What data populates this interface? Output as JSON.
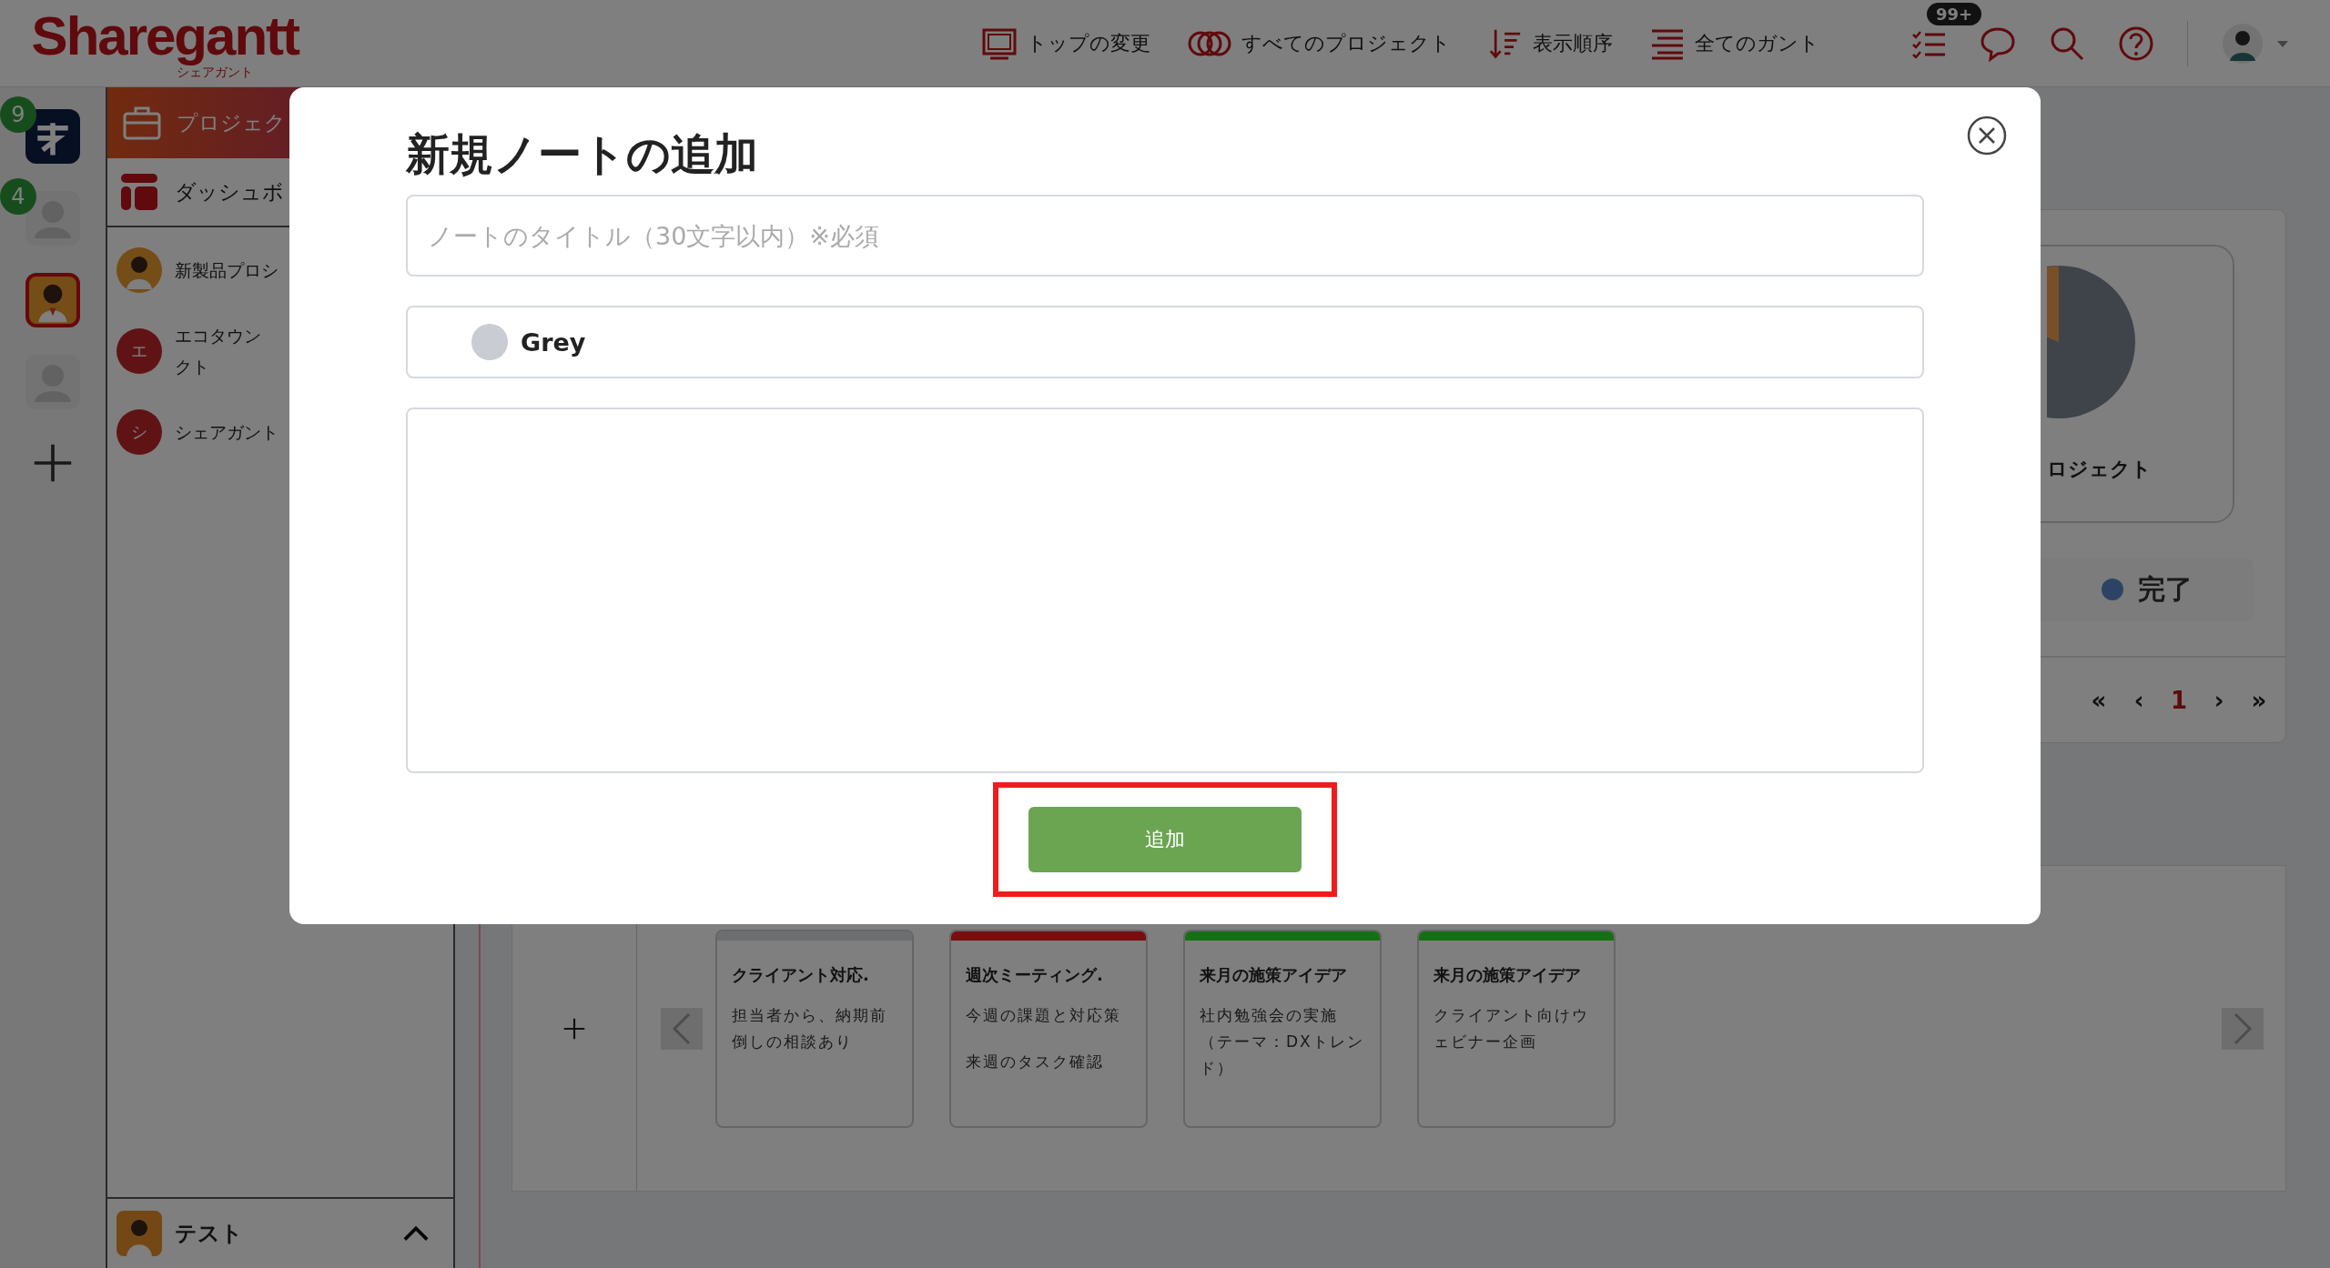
{
  "header": {
    "logo": "Sharegantt",
    "logo_sub": "シェアガント",
    "nav": [
      {
        "kind": "monitor",
        "label": "トップの変更"
      },
      {
        "kind": "rings",
        "label": "すべてのプロジェクト"
      },
      {
        "kind": "sort",
        "label": "表示順序"
      },
      {
        "kind": "lines",
        "label": "全てのガント"
      }
    ],
    "task_badge": "99+"
  },
  "rail": [
    {
      "kind": "app",
      "badge": "9",
      "selected": false
    },
    {
      "kind": "person",
      "badge": "4",
      "selected": false
    },
    {
      "kind": "character",
      "selected": true
    },
    {
      "kind": "person",
      "selected": false
    },
    {
      "kind": "add",
      "selected": false
    }
  ],
  "sidebar": {
    "title": "プロジェク",
    "dashboard": "ダッシュボ",
    "projects": [
      {
        "kind": "character",
        "lines": [
          "新製品プロシ"
        ]
      },
      {
        "kind": "initial",
        "initial": "エ",
        "lines": [
          "エコタウン",
          "クト"
        ]
      },
      {
        "kind": "initial",
        "initial": "シ",
        "lines": [
          "シェアガント"
        ]
      }
    ],
    "footer": {
      "label": "テスト",
      "expanded": true
    }
  },
  "summary": {
    "chart_label": "ロジェクト",
    "legend": [
      {
        "label": "完了",
        "color": "#2b4466"
      }
    ],
    "pagination": [
      {
        "label": "«",
        "selected": false
      },
      {
        "label": "‹",
        "selected": false
      },
      {
        "label": "1",
        "selected": true
      },
      {
        "label": "›",
        "selected": false
      },
      {
        "label": "»",
        "selected": false
      }
    ]
  },
  "notes": [
    {
      "title": "クライアント対応.",
      "paragraphs": [
        "担当者から、納期前倒しの相談あり"
      ],
      "color": "#6d6e70"
    },
    {
      "title": "週次ミーティング.",
      "paragraphs": [
        "今週の課題と対応策",
        "来週のタスク確認"
      ],
      "color": "#7a0d10"
    },
    {
      "title": "来月の施策アイデア",
      "paragraphs": [
        "社内勉強会の実施（テーマ：DXトレンド）"
      ],
      "color": "#157015"
    },
    {
      "title": "来月の施策アイデア",
      "paragraphs": [
        "クライアント向けウェビナー企画"
      ],
      "color": "#157015"
    }
  ],
  "modal": {
    "title": "新規ノートの追加",
    "title_field": {
      "placeholder": "ノートのタイトル（30文字以内）※必須"
    },
    "color_select": {
      "value": "Grey",
      "color": "#c9ccd2"
    },
    "submit": {
      "label": "追加",
      "highlighted": true
    }
  }
}
